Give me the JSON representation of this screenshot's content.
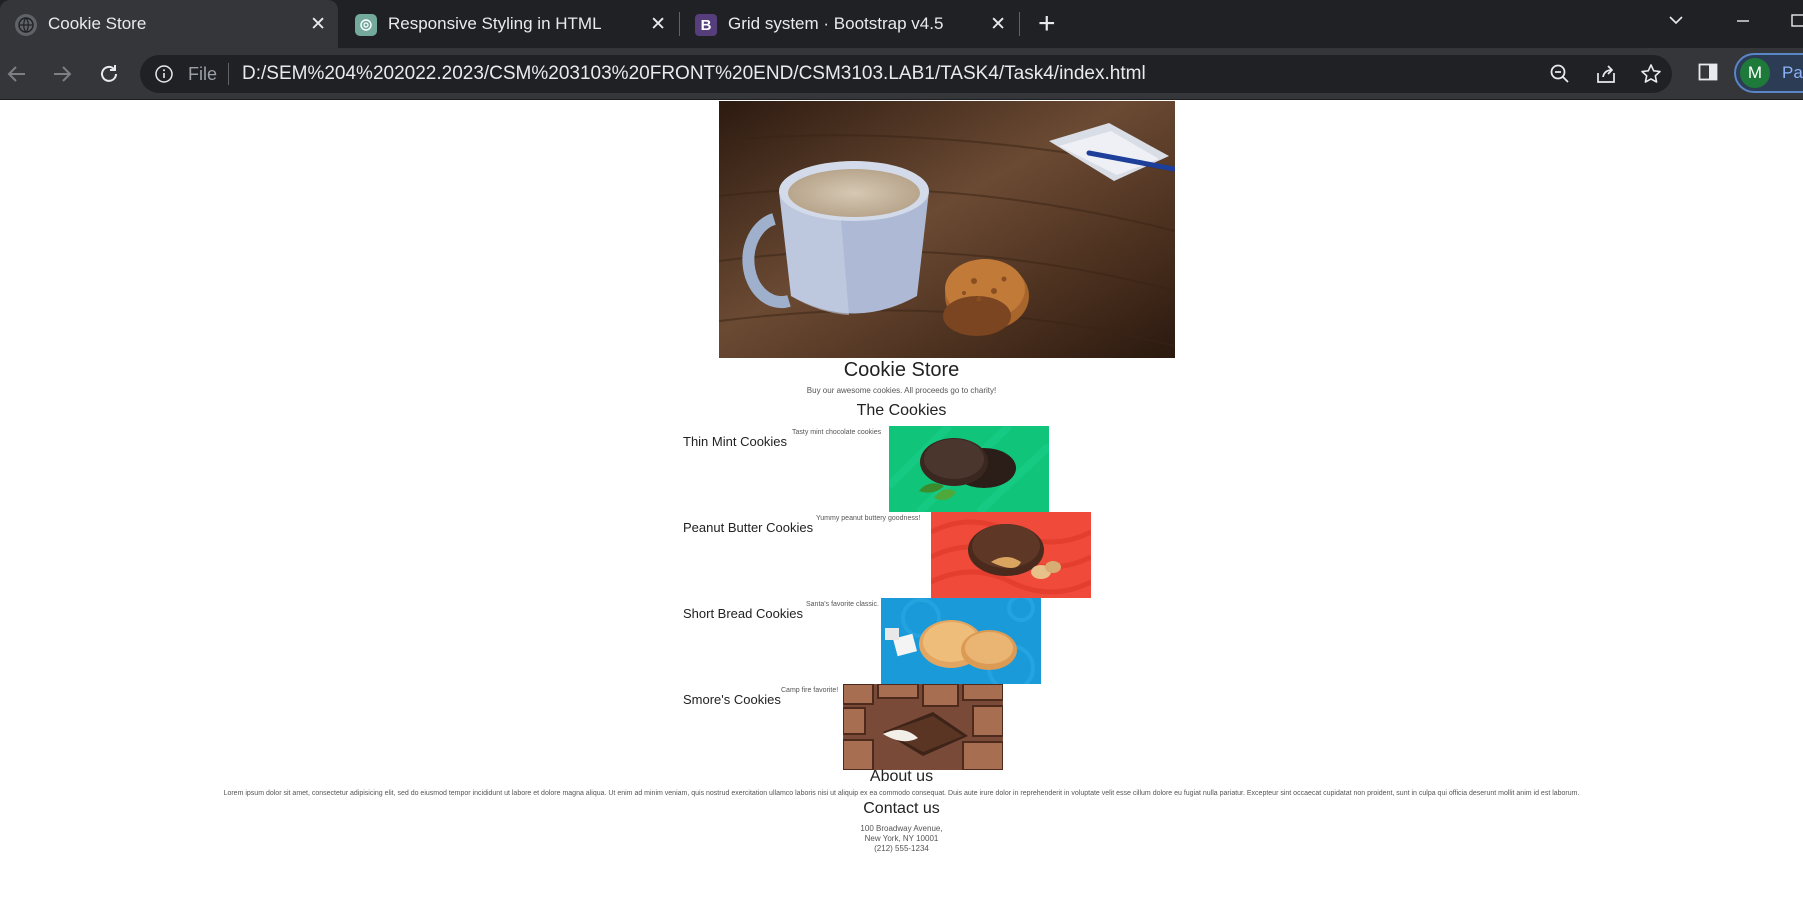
{
  "browser": {
    "tabs": [
      {
        "title": "Cookie Store",
        "active": true,
        "icon": "globe-icon"
      },
      {
        "title": "Responsive Styling in HTML",
        "active": false,
        "icon": "chatgpt-icon"
      },
      {
        "title": "Grid system · Bootstrap v4.5",
        "active": false,
        "icon": "bootstrap-icon"
      }
    ],
    "address": {
      "scheme_label": "File",
      "url": "D:/SEM%204%202022.2023/CSM%203103%20FRONT%20END/CSM3103.LAB1/TASK4/Task4/index.html"
    },
    "profile": {
      "initial": "M",
      "name": "Pau"
    }
  },
  "page": {
    "store_title": "Cookie Store",
    "store_subtitle": "Buy our awesome cookies. All proceeds go to charity!",
    "cookies_heading": "The Cookies",
    "cookies": [
      {
        "name": "Thin Mint Cookies",
        "desc": "Tasty mint chocolate cookies",
        "color": "#10c47a"
      },
      {
        "name": "Peanut Butter Cookies",
        "desc": "Yummy peanut buttery goodness!",
        "color": "#f04a3a"
      },
      {
        "name": "Short Bread Cookies",
        "desc": "Santa's favorite classic.",
        "color": "#1a9ad8"
      },
      {
        "name": "Smore's Cookies",
        "desc": "Camp fire favorite!",
        "color": "#7a4a38"
      }
    ],
    "about_heading": "About us",
    "about_text": "Lorem ipsum dolor sit amet, consectetur adipisicing elit, sed do eiusmod tempor incididunt ut labore et dolore magna aliqua. Ut enim ad minim veniam, quis nostrud exercitation ullamco laboris nisi ut aliquip ex ea commodo consequat. Duis aute irure dolor in reprehenderit in voluptate velit esse cillum dolore eu fugiat nulla pariatur. Excepteur sint occaecat cupidatat non proident, sunt in culpa qui officia deserunt mollit anim id est laborum.",
    "contact_heading": "Contact us",
    "contact": {
      "line1": "100 Broadway Avenue,",
      "line2": "New York, NY 10001",
      "line3": "(212) 555-1234"
    }
  }
}
